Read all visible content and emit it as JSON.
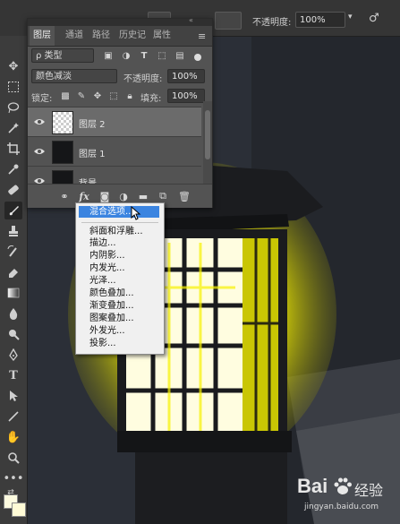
{
  "options_bar": {
    "opacity_label": "不透明度:",
    "opacity_value": "100%"
  },
  "layers_panel": {
    "tabs": [
      {
        "label": "图层"
      },
      {
        "label": "通道"
      },
      {
        "label": "路径"
      },
      {
        "label": "历史记"
      },
      {
        "label": "属性"
      }
    ],
    "filter_kind": "ρ 类型",
    "blend_mode": "颜色减淡",
    "opacity_label": "不透明度:",
    "opacity_value": "100%",
    "lock_label": "锁定:",
    "fill_label": "填充:",
    "fill_value": "100%",
    "layers": [
      {
        "name": "图层 2",
        "selected": true,
        "thumb": "transparent"
      },
      {
        "name": "图层 1",
        "selected": false,
        "thumb": "dark"
      },
      {
        "name": "背景",
        "selected": false,
        "thumb": "dark"
      }
    ],
    "bottom_fx_label": "fx"
  },
  "fx_menu": {
    "items": [
      {
        "label": "混合选项..."
      },
      {
        "label": "斜面和浮雕..."
      },
      {
        "label": "描边..."
      },
      {
        "label": "内阴影..."
      },
      {
        "label": "内发光..."
      },
      {
        "label": "光泽..."
      },
      {
        "label": "颜色叠加..."
      },
      {
        "label": "渐变叠加..."
      },
      {
        "label": "图案叠加..."
      },
      {
        "label": "外发光..."
      },
      {
        "label": "投影..."
      }
    ]
  },
  "watermark": {
    "brand": "Bai",
    "brand_suffix": "经验",
    "url": "jingyan.baidu.com"
  },
  "colors": {
    "accent": "#3b84e0",
    "glow": "#ffff1a",
    "panel": "#535353"
  }
}
